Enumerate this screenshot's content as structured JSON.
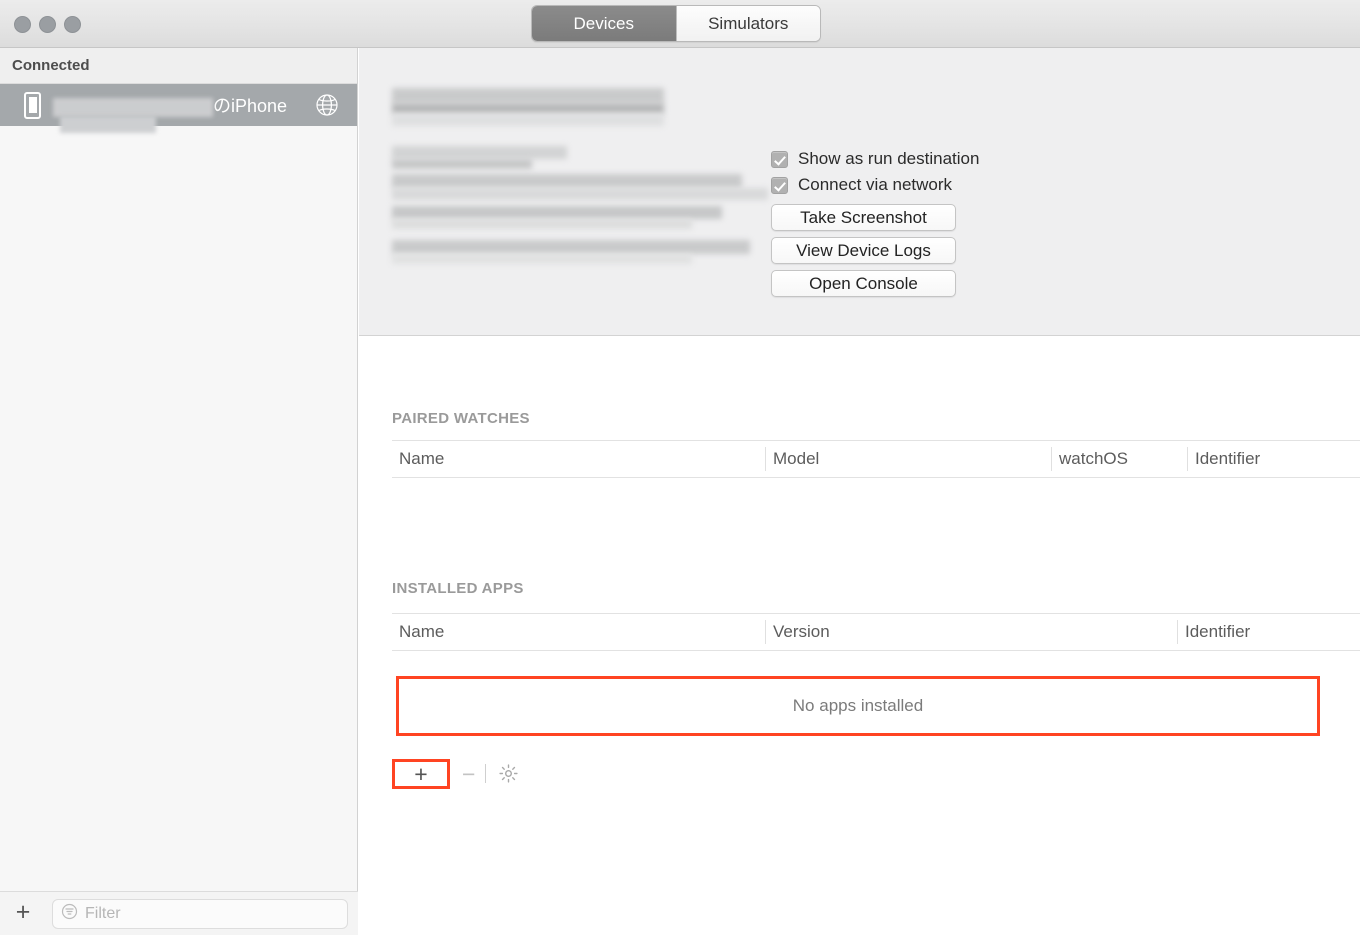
{
  "window": {
    "traffic_lights": [
      "close",
      "minimize",
      "zoom"
    ]
  },
  "tabs": {
    "devices_label": "Devices",
    "simulators_label": "Simulators",
    "selected": "Devices"
  },
  "sidebar": {
    "section_header": "Connected",
    "device": {
      "name_suffix": "のiPhone",
      "name_redacted": true,
      "icon": "iphone-icon",
      "network_icon": "globe-icon",
      "selected": true
    },
    "add_label": "+",
    "filter": {
      "placeholder": "Filter",
      "value": "",
      "icon": "filter-icon"
    }
  },
  "detail": {
    "info_redacted": true,
    "options": [
      {
        "label": "Show as run destination",
        "checked": true
      },
      {
        "label": "Connect via network",
        "checked": true
      }
    ],
    "buttons": [
      {
        "label": "Take Screenshot"
      },
      {
        "label": "View Device Logs"
      },
      {
        "label": "Open Console"
      }
    ],
    "device_artwork": "iphone-device-image"
  },
  "paired_watches": {
    "title": "PAIRED WATCHES",
    "columns": [
      "Name",
      "Model",
      "watchOS",
      "Identifier"
    ],
    "rows": []
  },
  "installed_apps": {
    "title": "INSTALLED APPS",
    "columns": [
      "Name",
      "Version",
      "Identifier"
    ],
    "rows": [],
    "empty_message": "No apps installed",
    "toolbar": {
      "add_label": "+",
      "remove_label": "−",
      "settings_icon": "gear-icon"
    }
  },
  "annotations": {
    "highlight_color": "#ff4422",
    "highlighted": [
      "no-apps-installed-row",
      "add-app-button"
    ]
  }
}
